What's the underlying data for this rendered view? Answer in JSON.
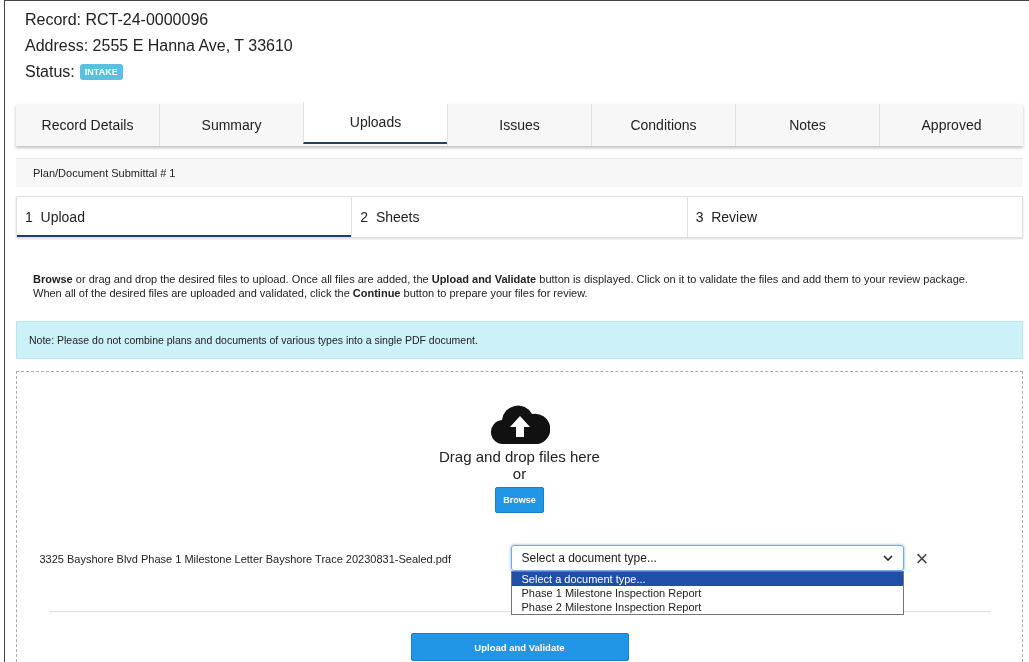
{
  "record": {
    "label": "Record:",
    "value": "RCT-24-0000096"
  },
  "address": {
    "label": "Address:",
    "value": "2555 E Hanna Ave, T 33610"
  },
  "status": {
    "label": "Status:",
    "badge": "INTAKE"
  },
  "tabs": [
    {
      "label": "Record Details",
      "selected": false
    },
    {
      "label": "Summary",
      "selected": false
    },
    {
      "label": "Uploads",
      "selected": true
    },
    {
      "label": "Issues",
      "selected": false
    },
    {
      "label": "Conditions",
      "selected": false
    },
    {
      "label": "Notes",
      "selected": false
    },
    {
      "label": "Approved",
      "selected": false
    }
  ],
  "submittal_title": "Plan/Document Submittal # 1",
  "steps": [
    {
      "number": "1",
      "label": "Upload",
      "selected": true
    },
    {
      "number": "2",
      "label": "Sheets",
      "selected": false
    },
    {
      "number": "3",
      "label": "Review",
      "selected": false
    }
  ],
  "instructions": "**Browse** or drag and drop the desired files to upload. Once all files are added, the **Upload and Validate** button is displayed. Click on it to validate the files and add them to your review package. When all of the desired files are uploaded and validated, click the **Continue** button to prepare your files for review.",
  "note": "Note: Please do not combine plans and documents of various types into a single PDF document.",
  "dropzone": {
    "title": "Drag and drop files here",
    "or": "or",
    "browse_button": "Browse"
  },
  "files": [
    {
      "name": "3325 Bayshore Blvd Phase 1 Milestone Letter Bayshore Trace 20230831-Sealed.pdf",
      "document_type": {
        "value": "Select a document type...",
        "expanded": true,
        "options": [
          {
            "label": "Select a document type...",
            "selected": true
          },
          {
            "label": "Phase 1 Milestone Inspection Report",
            "selected": false
          },
          {
            "label": "Phase 2 Milestone Inspection Report",
            "selected": false
          }
        ]
      },
      "remove": "×"
    }
  ],
  "upload_button": "Upload and Validate"
}
